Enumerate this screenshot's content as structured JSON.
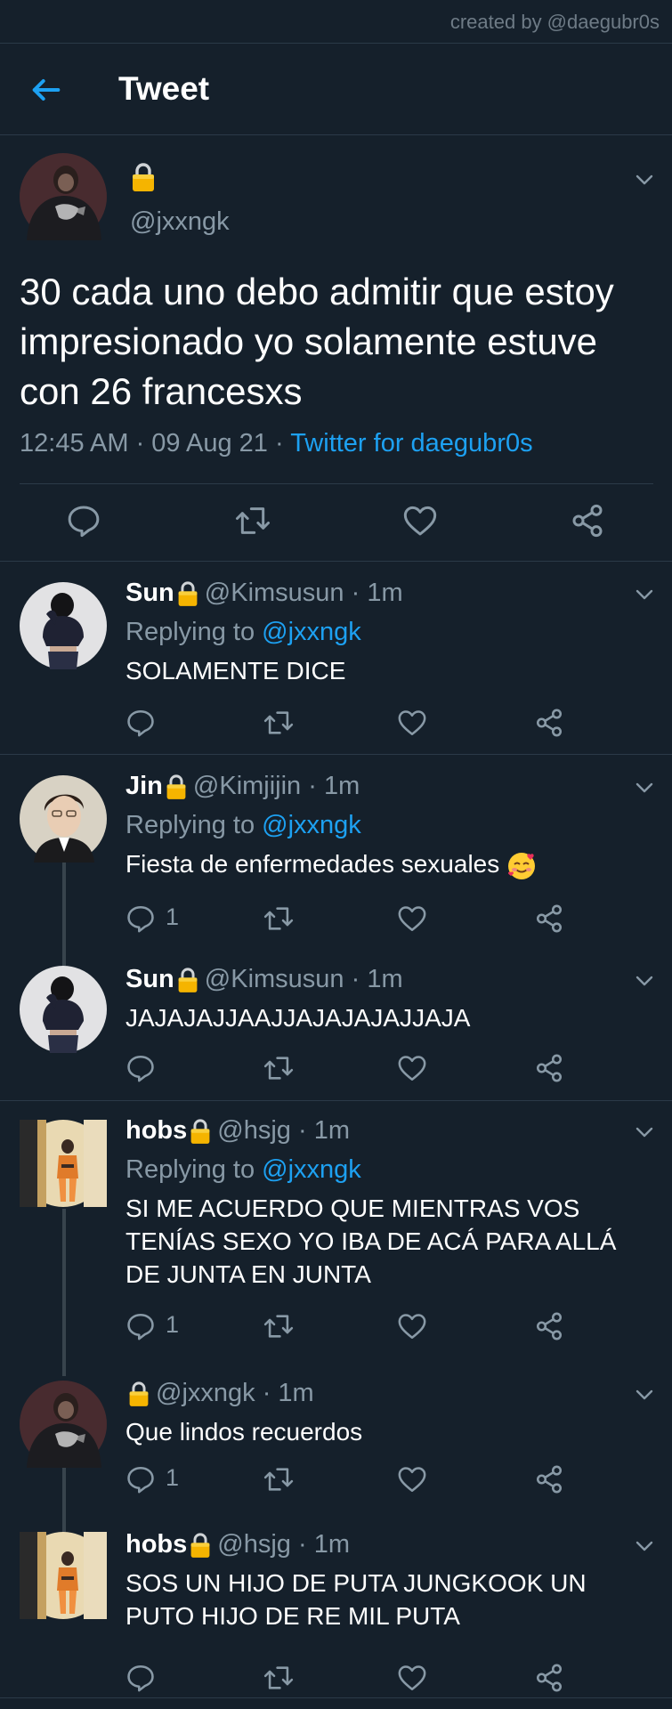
{
  "credit": "created by @daegubr0s",
  "header": {
    "title": "Tweet"
  },
  "main_tweet": {
    "handle": "@jxxngk",
    "text": "30 cada uno debo admitir que estoy impresionado yo solamente estuve con 26 francesxs",
    "time": "12:45 AM · 09 Aug 21 · ",
    "client": "Twitter for daegubr0s"
  },
  "replies": [
    {
      "name": "Sun",
      "handle": "@Kimsusun",
      "time": "· 1m",
      "replying_label": "Replying to ",
      "replying_to": "@jxxngk",
      "text": "SOLAMENTE DICE",
      "reply_count": ""
    },
    {
      "name": "Jin",
      "handle": "@Kimjijin",
      "time": "· 1m",
      "replying_label": "Replying to ",
      "replying_to": "@jxxngk",
      "text": "Fiesta de enfermedades sexuales",
      "reply_count": "1"
    },
    {
      "name": "Sun",
      "handle": "@Kimsusun",
      "time": "· 1m",
      "text": "JAJAJAJJAAJJAJAJAJAJJAJA",
      "reply_count": ""
    },
    {
      "name": "hobs",
      "handle": "@hsjg",
      "time": "· 1m",
      "replying_label": "Replying to ",
      "replying_to": "@jxxngk",
      "text": "SI ME ACUERDO QUE MIENTRAS VOS TENÍAS SEXO YO IBA DE ACÁ PARA ALLÁ DE JUNTA EN JUNTA",
      "reply_count": "1"
    },
    {
      "name": "",
      "handle": "@jxxngk",
      "time": "· 1m",
      "text": "Que lindos recuerdos",
      "reply_count": "1"
    },
    {
      "name": "hobs",
      "handle": "@hsjg",
      "time": "· 1m",
      "text": "SOS UN HIJO DE PUTA JUNGKOOK UN PUTO HIJO DE RE MIL PUTA",
      "reply_count": ""
    }
  ],
  "colors": {
    "background": "#15202b",
    "accent": "#1da1f2",
    "muted": "#8899a6",
    "divider": "#2b3a48"
  },
  "icons": [
    "back-arrow-icon",
    "lock-icon",
    "chevron-down-icon",
    "reply-icon",
    "retweet-icon",
    "like-icon",
    "share-icon",
    "smiling-face-with-hearts-icon"
  ]
}
